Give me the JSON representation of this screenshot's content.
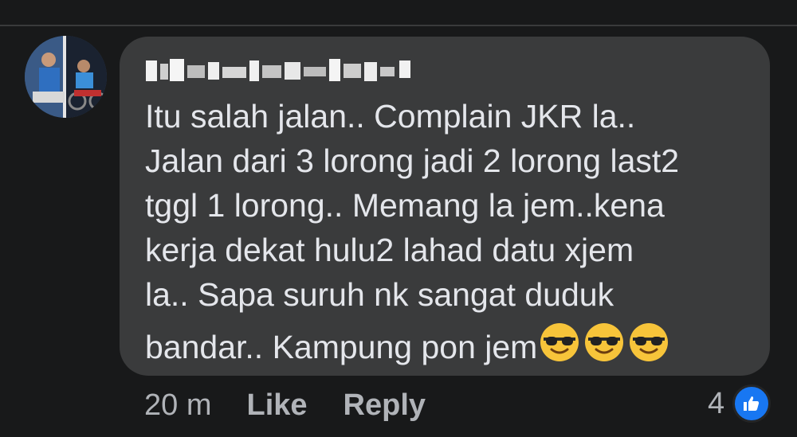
{
  "comment": {
    "author_name": "",
    "text_lines": [
      "Itu salah jalan.. Complain JKR la..",
      "Jalan dari 3 lorong jadi 2 lorong last2",
      "tggl 1 lorong.. Memang la jem..kena",
      "kerja dekat hulu2 lahad datu xjem",
      "la.. Sapa suruh nk sangat duduk",
      "bandar.. Kampung pon jem"
    ],
    "emojis": [
      "smiling-face-with-sunglasses",
      "smiling-face-with-sunglasses",
      "smiling-face-with-sunglasses"
    ]
  },
  "footer": {
    "timestamp": "20 m",
    "like_label": "Like",
    "reply_label": "Reply"
  },
  "reactions": {
    "count": "4",
    "icon": "thumbs-up-icon",
    "color": "#1877f2"
  },
  "colors": {
    "background": "#18191a",
    "bubble": "#3a3b3c",
    "text": "#e4e6eb",
    "secondary_text": "#b0b3b8"
  }
}
